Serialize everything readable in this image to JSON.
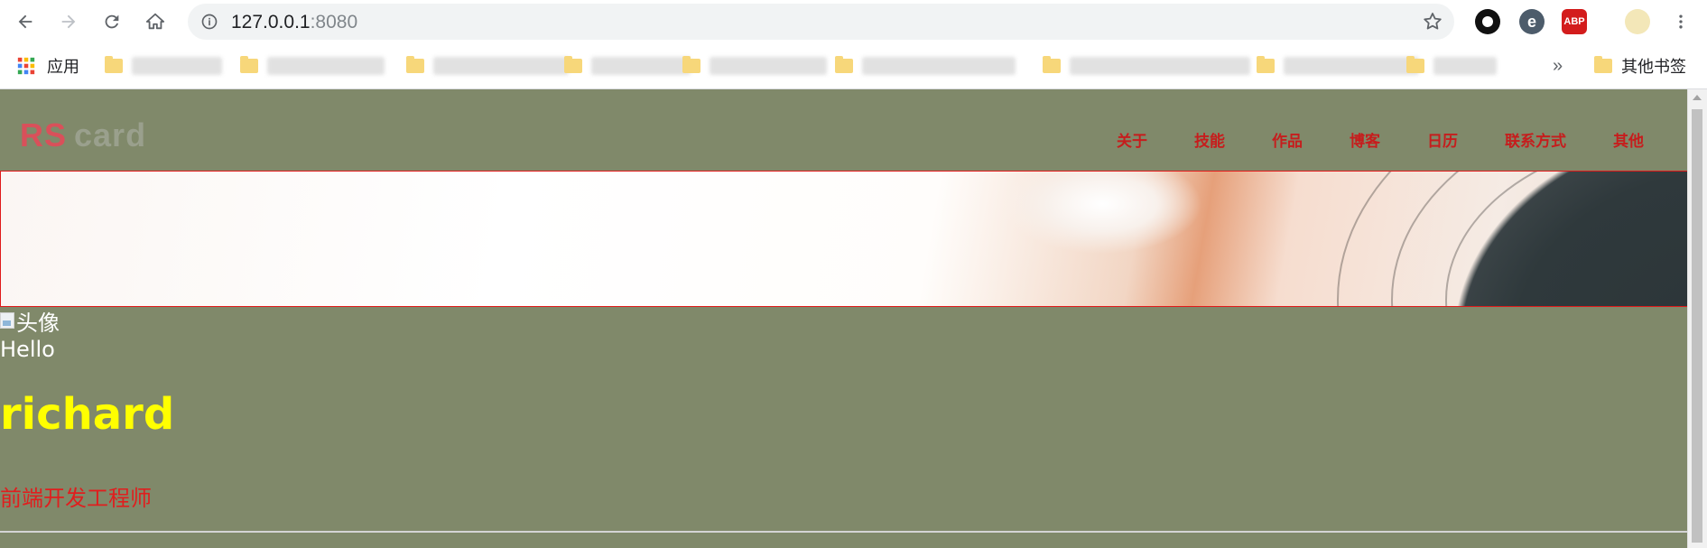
{
  "browser": {
    "url_host": "127.0.0.1",
    "url_port": ":8080",
    "bookmarks": {
      "apps_label": "应用",
      "other_bookmarks_label": "其他书签",
      "overflow_label": "»"
    },
    "extensions": [
      "black-circle-extension-icon",
      "e-extension-icon",
      "abp-icon",
      "profile-avatar-icon"
    ],
    "abp_label": "ABP"
  },
  "site": {
    "brand": {
      "rs": "RS",
      "card": "card"
    },
    "nav": [
      "关于",
      "技能",
      "作品",
      "博客",
      "日历",
      "联系方式",
      "其他"
    ]
  },
  "profile": {
    "avatar_alt": "头像",
    "greeting": "Hello",
    "name": "richard",
    "job_title": "前端开发工程师"
  },
  "colors": {
    "page_bg": "#80896a",
    "nav_link": "#c61d1d",
    "name": "#ffff00",
    "job_title": "#e01e1e",
    "banner_border": "#e01a1a"
  }
}
